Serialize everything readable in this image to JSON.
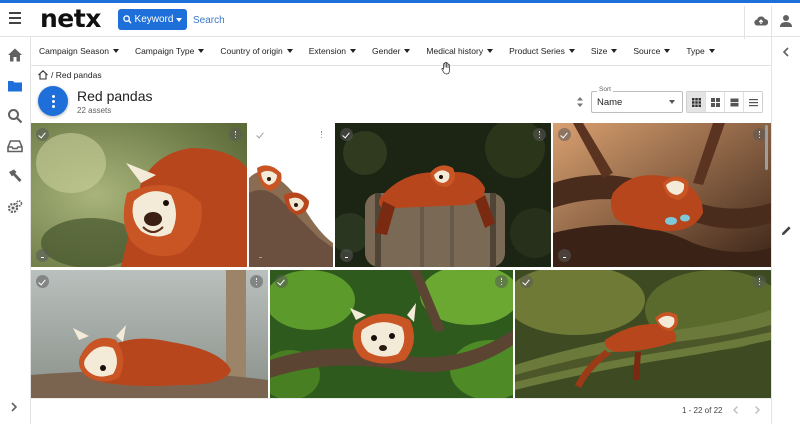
{
  "app": {
    "logo": "netx"
  },
  "header": {
    "keyword_label": "Keyword",
    "search_placeholder": "Search"
  },
  "filters": [
    "Campaign Season",
    "Campaign Type",
    "Country of origin",
    "Extension",
    "Gender",
    "Medical history",
    "Product Series",
    "Size",
    "Source",
    "Type"
  ],
  "breadcrumb": {
    "current": "/ Red pandas"
  },
  "folder": {
    "title": "Red pandas",
    "count": "22 assets"
  },
  "sort": {
    "label": "Sort",
    "value": "Name"
  },
  "view_modes": [
    "grid-large",
    "grid-small",
    "list-compact",
    "list"
  ],
  "assets": [
    {
      "subject": "red panda close-up"
    },
    {
      "subject": "two red pandas on tree"
    },
    {
      "subject": "red panda on wooden barrel"
    },
    {
      "subject": "red panda curled on branches"
    },
    {
      "subject": "red panda resting on log"
    },
    {
      "subject": "red panda in green leaves"
    },
    {
      "subject": "red panda sleeping on mossy branch"
    }
  ],
  "pagination": {
    "text": "1 - 22 of 22"
  },
  "colors": {
    "accent": "#1e6fd9"
  }
}
